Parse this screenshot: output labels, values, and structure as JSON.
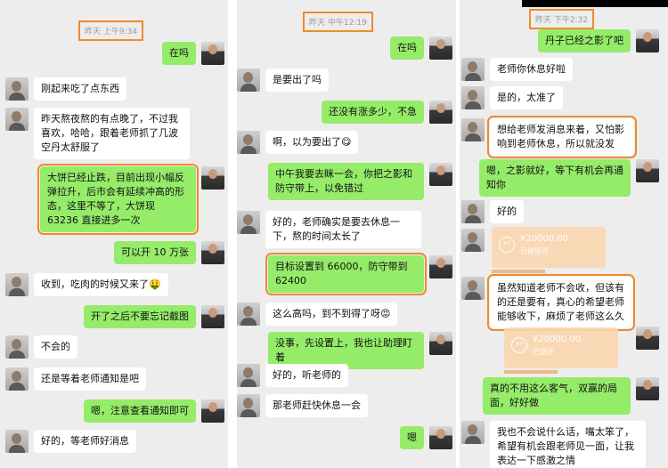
{
  "panels": [
    {
      "timestamp": "昨天 上午9:34",
      "messages": [
        {
          "side": "right",
          "text": "在吗"
        },
        {
          "side": "left",
          "text": "刚起来吃了点东西"
        },
        {
          "side": "left",
          "text": "昨天熬夜熬的有点晚了，不过我喜欢，哈哈，跟着老师抓了几波空丹太舒服了"
        },
        {
          "side": "right",
          "text": "大饼已经止跌，目前出现小幅反弹拉升，后市会有延续冲高的形态，这里不等了，大饼现 63236 直接进多一次",
          "highlight": true
        },
        {
          "side": "right",
          "text": "可以开 10 万张"
        },
        {
          "side": "left",
          "text": "收到，吃肉的时候又来了🤑"
        },
        {
          "side": "right",
          "text": "开了之后不要忘记截图"
        },
        {
          "side": "left",
          "text": "不会的"
        },
        {
          "side": "left",
          "text": "还是等着老师通知是吧"
        },
        {
          "side": "right",
          "text": "嗯，注意查看通知即可"
        },
        {
          "side": "left",
          "text": "好的，等老师好消息"
        }
      ]
    },
    {
      "timestamp": "昨天 中午12:19",
      "messages": [
        {
          "side": "right",
          "text": "在吗"
        },
        {
          "side": "left",
          "text": "是要出了吗"
        },
        {
          "side": "right",
          "text": "还没有涨多少，不急"
        },
        {
          "side": "left",
          "text": "啊，以为要出了😋"
        },
        {
          "side": "right",
          "text": "中午我要去眯一会，你把之影和防守带上，以免错过"
        },
        {
          "side": "left",
          "text": "好的，老师确实是要去休息一下，熬的时间太长了"
        },
        {
          "side": "right",
          "text": "目标设置到 66000，防守带到 62400",
          "highlight": true
        },
        {
          "side": "left",
          "text": "这么高吗，到不到得了呀😡"
        },
        {
          "side": "right",
          "text": "没事，先设置上，我也让助理盯着"
        },
        {
          "side": "left",
          "text": "好的，听老师的"
        },
        {
          "side": "left",
          "text": "那老师赶快休息一会"
        },
        {
          "side": "right",
          "text": "嗯"
        }
      ]
    },
    {
      "timestamp": "昨天 下午2:32",
      "messages": [
        {
          "side": "right",
          "text": "丹子已经之影了吧"
        },
        {
          "side": "left",
          "text": "老师你休息好啦"
        },
        {
          "side": "left",
          "text": "是的，太准了"
        },
        {
          "side": "left",
          "text": "想给老师发消息来着，又怕影响到老师休息，所以就没发",
          "highlight": true
        },
        {
          "side": "right",
          "text": "嗯，之影就好，等下有机会再通知你"
        },
        {
          "side": "left",
          "text": "好的"
        },
        {
          "side": "left",
          "text": "虽然知道老师不会收，但该有的还是要有，真心的希望老师能够收下，麻烦了老师这么久",
          "highlight": true
        },
        {
          "side": "right",
          "text": "真的不用这么客气，双赢的局面，好好做"
        },
        {
          "side": "left",
          "text": "我也不会说什么话，嘴太笨了，希望有机会跟老师见一面，让我表达一下感激之情"
        }
      ],
      "transfers": [
        {
          "amount": "¥20000.00",
          "status": "已被退还"
        },
        {
          "amount": "¥20000.00",
          "status": "已退还"
        }
      ]
    }
  ]
}
